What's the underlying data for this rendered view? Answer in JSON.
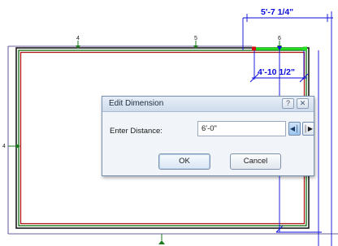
{
  "drawing": {
    "dimensions": {
      "outer": "5'-7 1/4\"",
      "inner": "4'-10 1/2\""
    },
    "grid_labels": {
      "grid_4": "4",
      "grid_5": "5",
      "grid_6": "6",
      "left_marker": "4"
    }
  },
  "dialog": {
    "title": "Edit Dimension",
    "help_icon": "?",
    "close_icon": "✕",
    "distance_label": "Enter Distance:",
    "distance_value": "6'-0\"",
    "dir_left_icon": "◀│",
    "dir_right_icon": "│▶",
    "ok_label": "OK",
    "cancel_label": "Cancel"
  },
  "colors": {
    "dimension_blue": "#0a0adc",
    "wall_green": "#1e7a1e",
    "wall_red": "#b01414",
    "wall_black": "#1a1a1a",
    "highlight_green": "#23e020"
  }
}
